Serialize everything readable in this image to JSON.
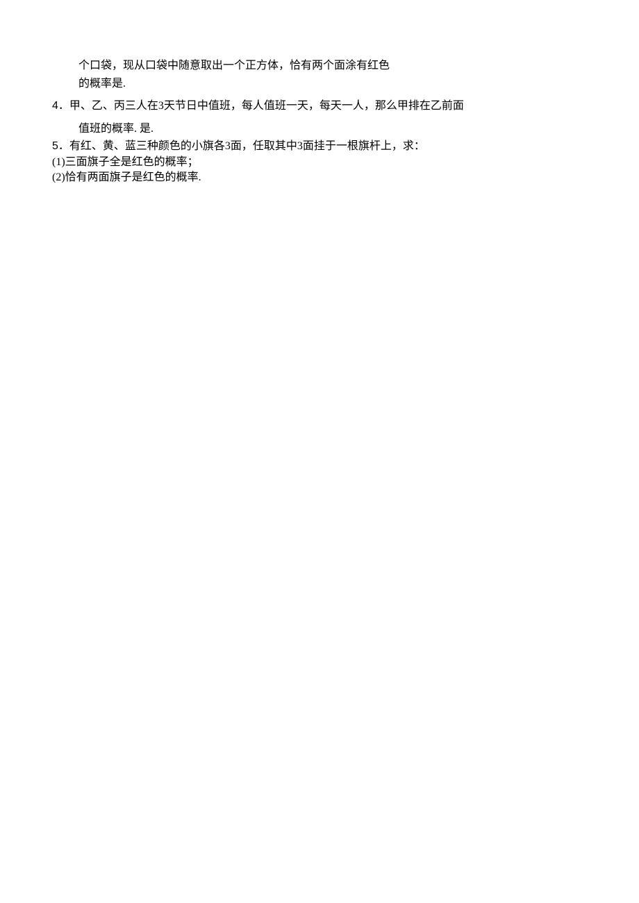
{
  "q3": {
    "cont_line1": "个口袋，现从口袋中随意取出一个正方体，恰有两个面涂有红色",
    "cont_line2": "的概率是."
  },
  "q4": {
    "number": "4",
    "dot": "．",
    "text": "甲、乙、丙三人在3天节日中值班，每人值班一天，每天一人，那么甲排在乙前面",
    "tail": "值班的概率. 是."
  },
  "q5": {
    "number": "5",
    "dot": "．",
    "text": "有红、黄、蓝三种颜色的小旗各3面，任取其中3面挂于一根旗杆上，求：",
    "sub1_label": "(1)",
    "sub1_text": "三面旗子全是红色的概率；",
    "sub2_label": "(2)",
    "sub2_text": "恰有两面旗子是红色的概率."
  }
}
